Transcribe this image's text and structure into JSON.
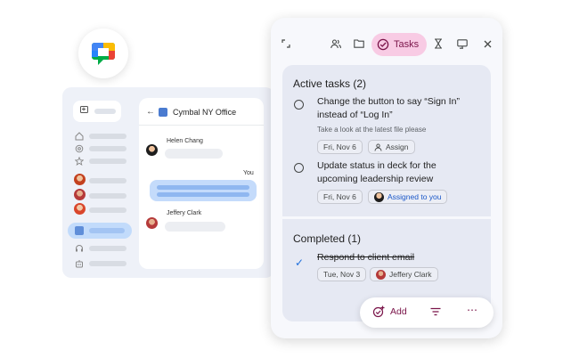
{
  "app_logo": {
    "icon": "chat-logo-icon"
  },
  "chat_window": {
    "room_name": "Cymbal NY Office",
    "messages": [
      {
        "sender": "Helen Chang"
      },
      {
        "sender": "You"
      },
      {
        "sender": "Jeffery Clark"
      }
    ]
  },
  "tasks_panel": {
    "toolbar": {
      "collapse_icon": "collapse-icon",
      "people_icon": "people-icon",
      "folder_icon": "folder-icon",
      "tasks_tab_label": "Tasks",
      "apps_icon": "hourglass-icon",
      "cast_icon": "present-icon",
      "close_icon": "close-icon"
    },
    "active_section_title": "Active tasks (2)",
    "active_tasks": [
      {
        "title": "Change the button to say “Sign In” instead of “Log In”",
        "description": "Take a look at the latest file please",
        "date": "Fri, Nov 6",
        "assignee": "Assign"
      },
      {
        "title": "Update status in deck for the upcoming leadership review",
        "date": "Fri, Nov 6",
        "assignee": "Assigned to you"
      }
    ],
    "completed_section_title": "Completed (1)",
    "completed_tasks": [
      {
        "title": "Respond to client email",
        "date": "Tue, Nov 3",
        "assignee": "Jeffery Clark"
      }
    ],
    "bottom_bar": {
      "add_label": "Add"
    }
  },
  "colors": {
    "tab_pink": "#f8cbe4",
    "accent_dark_pink": "#7a1449",
    "card_bg": "#e6e9f3",
    "assigned_blue": "#1a57c8",
    "check_blue": "#1f6fdc"
  }
}
